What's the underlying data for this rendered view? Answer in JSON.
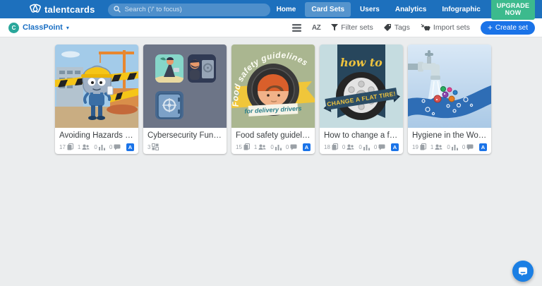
{
  "navbar": {
    "brand": "talentcards",
    "search_placeholder": "Search ('/' to focus)",
    "items": [
      {
        "label": "Home"
      },
      {
        "label": "Card Sets"
      },
      {
        "label": "Users"
      },
      {
        "label": "Analytics"
      },
      {
        "label": "Infographic"
      }
    ],
    "upgrade_label": "UPGRADE NOW",
    "help_label": "?"
  },
  "toolbar": {
    "group_initial": "C",
    "group_name": "ClassPoint",
    "sort_label": "AZ",
    "filter_label": "Filter sets",
    "tags_label": "Tags",
    "import_label": "Import sets",
    "create_label": "Create set",
    "create_plus": "+"
  },
  "cards": [
    {
      "title": "Avoiding Hazards in the ...",
      "cards_count": "17",
      "groups_count": "1",
      "progress_count": "0",
      "feedback_count": "0",
      "language": "A"
    },
    {
      "title": "Cybersecurity Fundame...",
      "sets_count": "3"
    },
    {
      "title": "Food safety guidelines f...",
      "cards_count": "15",
      "groups_count": "1",
      "progress_count": "0",
      "feedback_count": "0",
      "language": "A"
    },
    {
      "title": "How to change a flat tire",
      "cards_count": "18",
      "groups_count": "0",
      "progress_count": "0",
      "feedback_count": "0",
      "language": "A"
    },
    {
      "title": "Hygiene in the Workplace",
      "cards_count": "19",
      "groups_count": "1",
      "progress_count": "0",
      "feedback_count": "0",
      "language": "A"
    }
  ],
  "card_art": {
    "food_safety": {
      "arc_text": "Food safety guidelines",
      "banner_text": "for delivery drivers"
    },
    "flat_tire": {
      "top_text": "how to",
      "ribbon_text": "CHANGE A FLAT TIRE!"
    }
  },
  "colors": {
    "navbar_blue": "#1d70bd",
    "upgrade_green": "#3cba8d",
    "accent_blue": "#1a73e8",
    "avatar_green": "#2aa79b",
    "page_bg": "#ebedee"
  }
}
